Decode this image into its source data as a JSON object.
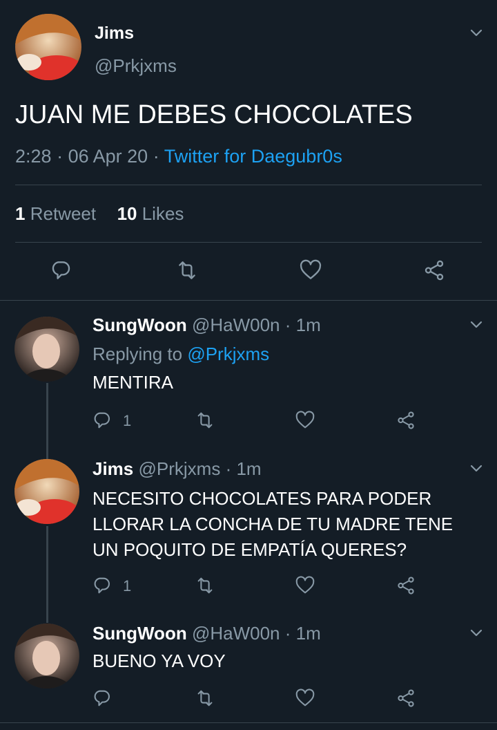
{
  "main_tweet": {
    "name": "Jims",
    "handle": "@Prkjxms",
    "text": "JUAN ME DEBES CHOCOLATES",
    "time": "2:28",
    "dot1": "·",
    "date": "06 Apr 20",
    "dot2": "·",
    "source": "Twitter for Daegubr0s",
    "retweet_count": "1",
    "retweet_label": "Retweet",
    "likes_count": "10",
    "likes_label": "Likes"
  },
  "replies": [
    {
      "name": "SungWoon",
      "handle": "@HaW00n",
      "time": "· 1m",
      "replying_prefix": "Replying to",
      "replying_to": "@Prkjxms",
      "lines": [
        "MENTIRA"
      ],
      "reply_count": "1"
    },
    {
      "name": "Jims",
      "handle": "@Prkjxms",
      "time": "· 1m",
      "lines": [
        "NECESITO CHOCOLATES PARA PODER",
        "LLORAR LA CONCHA DE TU MADRE TENE",
        "UN POQUITO DE EMPATÍA QUERES?"
      ],
      "reply_count": "1"
    },
    {
      "name": "SungWoon",
      "handle": "@HaW00n",
      "time": "· 1m",
      "lines": [
        "BUENO YA VOY"
      ],
      "reply_count": ""
    }
  ],
  "colors": {
    "background": "#141d26",
    "separator": "#38444d",
    "muted": "#8899a6",
    "link": "#1da1f2"
  },
  "icons": [
    "chevron-down-icon",
    "reply-icon",
    "retweet-icon",
    "like-icon",
    "share-icon"
  ]
}
